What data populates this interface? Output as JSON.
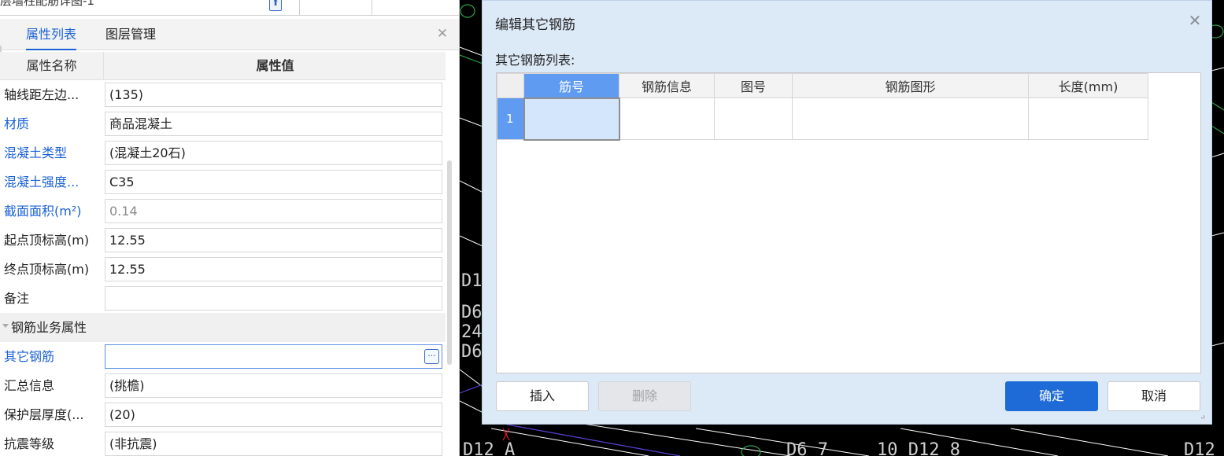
{
  "top_strip": {
    "name": "层墙柱配筋详图-1",
    "icon": "arrow-up-icon"
  },
  "panel": {
    "tabs": [
      {
        "label": "属性列表",
        "active": true
      },
      {
        "label": "图层管理",
        "active": false
      }
    ],
    "close_glyph": "✕"
  },
  "props": {
    "header": {
      "name": "属性名称",
      "value": "属性值"
    },
    "rows": [
      {
        "label": "轴线距左边...",
        "value": "(135)"
      },
      {
        "label": "材质",
        "value": "商品混凝土"
      },
      {
        "label": "混凝土类型",
        "value": "(混凝土20石)"
      },
      {
        "label": "混凝土强度...",
        "value": "C35"
      },
      {
        "label": "截面面积(m²)",
        "value": "0.14"
      },
      {
        "label": "起点顶标高(m)",
        "value": "12.55"
      },
      {
        "label": "终点顶标高(m)",
        "value": "12.55"
      },
      {
        "label": "备注",
        "value": ""
      }
    ],
    "group": {
      "label": "钢筋业务属性"
    },
    "rows2": [
      {
        "label": "其它钢筋",
        "value": ""
      },
      {
        "label": "汇总信息",
        "value": "(挑檐)"
      },
      {
        "label": "保护层厚度(...",
        "value": "(20)"
      },
      {
        "label": "抗震等级",
        "value": "(非抗震)"
      }
    ],
    "ellipsis_glyph": "···"
  },
  "dialog": {
    "title": "编辑其它钢筋",
    "close_glyph": "✕",
    "list_label": "其它钢筋列表:",
    "columns": [
      "筋号",
      "钢筋信息",
      "图号",
      "钢筋图形",
      "长度(mm)"
    ],
    "rows": [
      {
        "num": "1",
        "cells": [
          "",
          "",
          "",
          "",
          ""
        ]
      }
    ],
    "buttons": {
      "insert": "插入",
      "delete": "删除",
      "ok": "确定",
      "cancel": "取消"
    },
    "resize_glyph": "⠴"
  },
  "cad": {
    "texts": [
      {
        "text": "D1"
      },
      {
        "text": "D6"
      },
      {
        "text": "24"
      },
      {
        "text": "D6"
      },
      {
        "text": "D12 A"
      },
      {
        "text": "D6 7"
      },
      {
        "text": "10 D12 8"
      },
      {
        "text": "D12"
      }
    ]
  },
  "colors": {
    "accent": "#1b62d6",
    "grid_selected": "#5f9bf0",
    "ok_button": "#1e6ad6",
    "dialog_bg": "#dce9f7",
    "cad_bg": "#000000"
  }
}
